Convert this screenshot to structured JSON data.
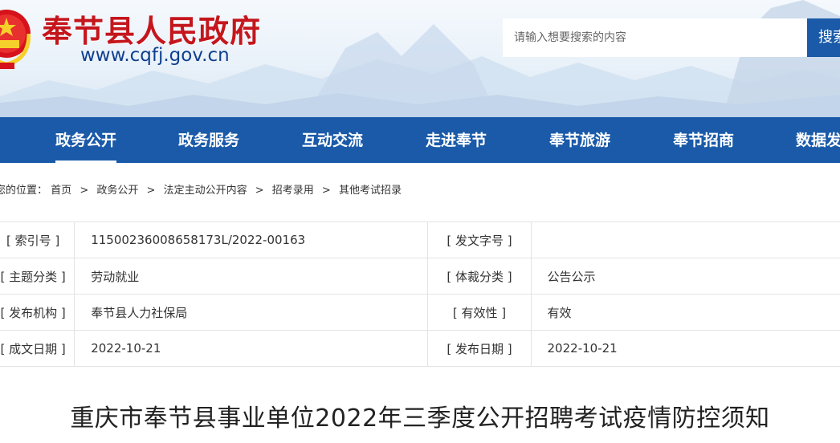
{
  "header": {
    "site_title": "奉节县人民政府",
    "site_url": "www.cqfj.gov.cn",
    "search_placeholder": "请输入想要搜索的内容",
    "search_button": "搜索"
  },
  "nav": {
    "items": [
      {
        "label": "政务公开",
        "active": true
      },
      {
        "label": "政务服务"
      },
      {
        "label": "互动交流"
      },
      {
        "label": "走进奉节"
      },
      {
        "label": "奉节旅游"
      },
      {
        "label": "奉节招商"
      },
      {
        "label": "数据发布"
      }
    ]
  },
  "breadcrumb": {
    "prefix": "您的位置：",
    "items": [
      "首页",
      "政务公开",
      "法定主动公开内容",
      "招考录用",
      "其他考试招录"
    ]
  },
  "info": {
    "rows": [
      {
        "label1": "[ 索引号 ]",
        "value1": "11500236008658173L/2022-00163",
        "label2": "[ 发文字号 ]",
        "value2": ""
      },
      {
        "label1": "[ 主题分类 ]",
        "value1": "劳动就业",
        "label2": "[ 体裁分类 ]",
        "value2": "公告公示"
      },
      {
        "label1": "[ 发布机构 ]",
        "value1": "奉节县人力社保局",
        "label2": "[ 有效性 ]",
        "value2": "有效"
      },
      {
        "label1": "[ 成文日期 ]",
        "value1": "2022-10-21",
        "label2": "[ 发布日期 ]",
        "value2": "2022-10-21"
      }
    ]
  },
  "article": {
    "title": "重庆市奉节县事业单位2022年三季度公开招聘考试疫情防控须知"
  },
  "colors": {
    "brand_red": "#c4161c",
    "nav_blue": "#1a5aa8",
    "url_blue": "#0f3f8f"
  }
}
